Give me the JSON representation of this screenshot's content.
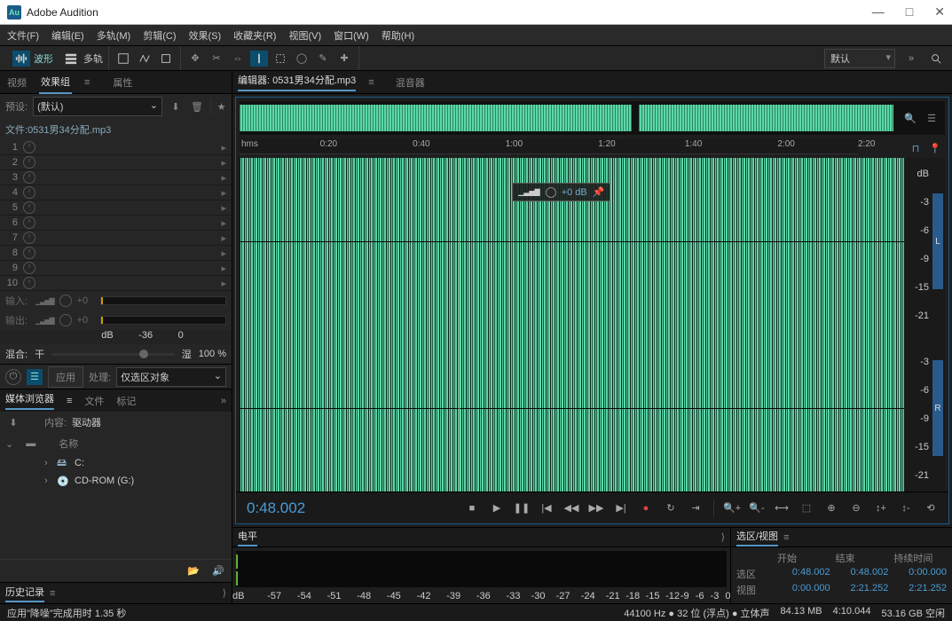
{
  "app": {
    "title": "Adobe Audition",
    "logo": "Au"
  },
  "menubar": [
    "文件(F)",
    "编辑(E)",
    "多轨(M)",
    "剪辑(C)",
    "效果(S)",
    "收藏夹(R)",
    "视图(V)",
    "窗口(W)",
    "帮助(H)"
  ],
  "toolbar": {
    "waveform": "波形",
    "multitrack": "多轨",
    "workspace": "默认"
  },
  "effects": {
    "tabs": {
      "video": "视频",
      "fxgroup": "效果组",
      "attrs": "属性"
    },
    "preset_label": "预设:",
    "preset_value": "(默认)",
    "file_label": "文件:",
    "file_name": "0531男34分配.mp3",
    "slots": [
      "1",
      "2",
      "3",
      "4",
      "5",
      "6",
      "7",
      "8",
      "9",
      "10"
    ],
    "input_label": "输入:",
    "output_label": "输出:",
    "io_val": "+0",
    "db_ticks": [
      "dB",
      "-36",
      "0"
    ],
    "mix_label": "混合:",
    "mix_dry": "干",
    "mix_wet": "湿",
    "mix_pct": "100 %",
    "apply": "应用",
    "process_label": "处理:",
    "process_value": "仅选区对象"
  },
  "browser": {
    "tabs": {
      "media": "媒体浏览器",
      "files": "文件",
      "markers": "标记"
    },
    "content_label": "内容:",
    "content_value": "驱动器",
    "name_hdr": "名称",
    "drives": [
      {
        "label": "C:"
      },
      {
        "label": "CD-ROM (G:)"
      }
    ],
    "history": "历史记录"
  },
  "editor": {
    "tabs": {
      "editor": "编辑器: 0531男34分配.mp3",
      "mixer": "混音器"
    },
    "ruler_unit": "hms",
    "ruler_ticks": [
      {
        "t": "0:20",
        "p": 13
      },
      {
        "t": "0:40",
        "p": 28
      },
      {
        "t": "1:00",
        "p": 43
      },
      {
        "t": "1:20",
        "p": 58
      },
      {
        "t": "1:40",
        "p": 72
      },
      {
        "t": "2:00",
        "p": 87
      },
      {
        "t": "2:20",
        "p": 100
      }
    ],
    "db_ticks": [
      "dB",
      "-3",
      "-6",
      "-9",
      "-15",
      "-21",
      "",
      "-3",
      "-6",
      "-9",
      "-15",
      "-21"
    ],
    "hud_db": "+0 dB",
    "ch_left": "L",
    "ch_right": "R",
    "timecode": "0:48.002"
  },
  "levels": {
    "title": "电平",
    "scale": [
      {
        "t": "dB",
        "p": 0
      },
      {
        "t": "-57",
        "p": 7
      },
      {
        "t": "-54",
        "p": 13
      },
      {
        "t": "-51",
        "p": 19
      },
      {
        "t": "-48",
        "p": 25
      },
      {
        "t": "-45",
        "p": 31
      },
      {
        "t": "-42",
        "p": 37
      },
      {
        "t": "-39",
        "p": 43
      },
      {
        "t": "-36",
        "p": 49
      },
      {
        "t": "-33",
        "p": 55
      },
      {
        "t": "-30",
        "p": 60
      },
      {
        "t": "-27",
        "p": 65
      },
      {
        "t": "-24",
        "p": 70
      },
      {
        "t": "-21",
        "p": 75
      },
      {
        "t": "-18",
        "p": 79
      },
      {
        "t": "-15",
        "p": 83
      },
      {
        "t": "-12",
        "p": 87
      },
      {
        "t": "-9",
        "p": 90
      },
      {
        "t": "-6",
        "p": 93
      },
      {
        "t": "-3",
        "p": 96
      },
      {
        "t": "0",
        "p": 99
      }
    ]
  },
  "selection": {
    "title": "选区/视图",
    "hdr_start": "开始",
    "hdr_end": "结束",
    "hdr_dur": "持续时间",
    "sel_label": "选区",
    "sel_start": "0:48.002",
    "sel_end": "0:48.002",
    "sel_dur": "0:00.000",
    "view_label": "视图",
    "view_start": "0:00.000",
    "view_end": "2:21.252",
    "view_dur": "2:21.252"
  },
  "status": {
    "msg": "应用\"降噪\"完成用时 1.35 秒",
    "format": "44100 Hz ● 32 位 (浮点) ● 立体声",
    "size": "84.13 MB",
    "sel": "4:10.044",
    "free": "53.16 GB 空闲"
  }
}
